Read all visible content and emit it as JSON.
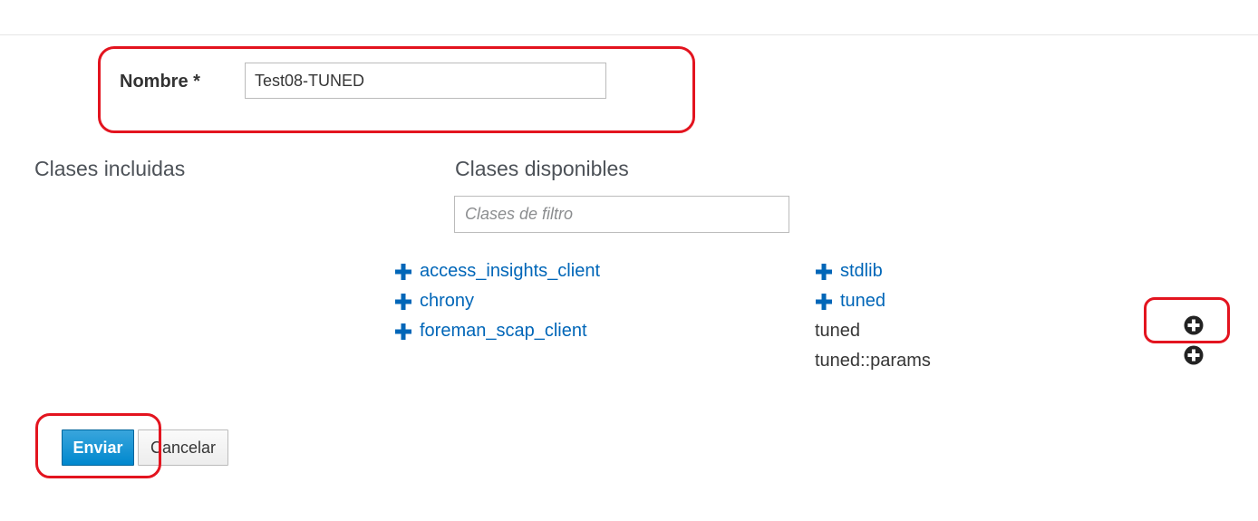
{
  "form": {
    "name_label": "Nombre *",
    "name_value": "Test08-TUNED"
  },
  "classes": {
    "included_heading": "Clases incluidas",
    "available_heading": "Clases disponibles",
    "filter_placeholder": "Clases de filtro",
    "groups_left": [
      {
        "label": "access_insights_client",
        "icon": "plus-icon"
      },
      {
        "label": "chrony",
        "icon": "plus-icon"
      },
      {
        "label": "foreman_scap_client",
        "icon": "plus-icon"
      }
    ],
    "groups_right": [
      {
        "label": "stdlib",
        "icon": "plus-icon"
      },
      {
        "label": "tuned",
        "icon": "plus-icon"
      }
    ],
    "expanded_classes": [
      {
        "label": "tuned",
        "action_icon": "plus-circle-icon"
      },
      {
        "label": "tuned::params",
        "action_icon": "plus-circle-icon"
      }
    ]
  },
  "buttons": {
    "submit_label": "Enviar",
    "cancel_label": "Cancelar"
  },
  "colors": {
    "link": "#0066b8",
    "submit": "#0088ce",
    "annotation": "#e3141f"
  }
}
